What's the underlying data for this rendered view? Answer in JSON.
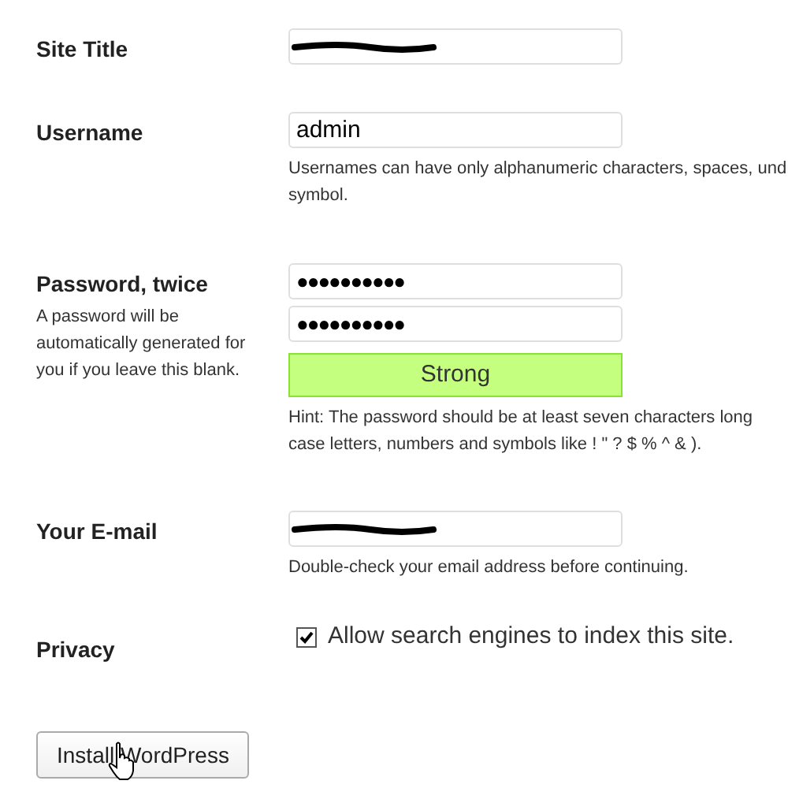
{
  "fields": [
    {
      "kind": "redacted",
      "label": "Site Title"
    },
    {
      "kind": "text",
      "label": "Username",
      "value": "admin",
      "hint_lines": [
        "Usernames can have only alphanumeric characters, spaces, und",
        "symbol."
      ]
    },
    {
      "kind": "password",
      "label": "Password, twice",
      "note": "A password will be automatically generated for you if you leave this blank.",
      "values": [
        "●●●●●●●●●●",
        "●●●●●●●●●●"
      ],
      "strength": "Strong",
      "hint_lines": [
        "Hint: The password should be at least seven characters long",
        "case letters, numbers and symbols like ! \" ? $ % ^ & )."
      ]
    },
    {
      "kind": "redacted",
      "label": "Your E-mail",
      "hint_lines": [
        "Double-check your email address before continuing."
      ]
    },
    {
      "kind": "checkbox",
      "label": "Privacy",
      "checkbox_label": "Allow search engines to index this site.",
      "checked": true
    }
  ],
  "submit": {
    "label": "Install WordPress"
  }
}
